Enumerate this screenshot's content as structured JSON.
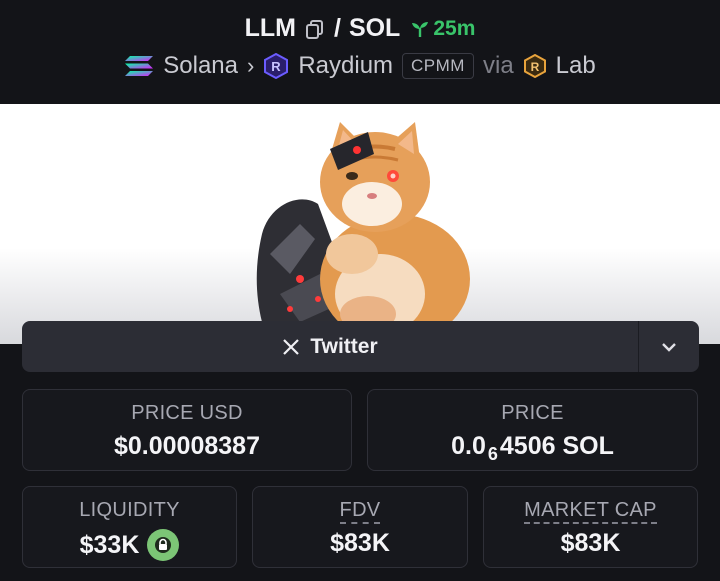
{
  "header": {
    "base": "LLM",
    "separator": "/",
    "quote": "SOL",
    "age": "25m",
    "chain": "Solana",
    "dex": "Raydium",
    "pool_type": "CPMM",
    "via": "via",
    "launchpad": "Lab"
  },
  "social": {
    "twitter_label": "Twitter"
  },
  "stats": {
    "price_usd_label": "PRICE USD",
    "price_usd": "$0.00008387",
    "price_label": "PRICE",
    "price_prefix": "0.0",
    "price_zeros": "6",
    "price_rest": "4506 SOL",
    "liquidity_label": "LIQUIDITY",
    "liquidity": "$33K",
    "fdv_label": "FDV",
    "fdv": "$83K",
    "mcap_label": "MARKET CAP",
    "mcap": "$83K"
  },
  "colors": {
    "background": "#131418",
    "age_green": "#39c46a",
    "lock_green": "#7cc576",
    "raydium_purple": "#6b5cff",
    "lab_orange": "#e8a33c"
  }
}
